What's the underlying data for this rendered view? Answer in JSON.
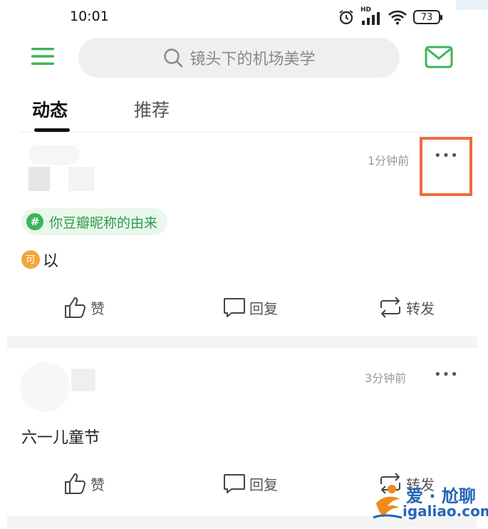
{
  "status_bar": {
    "time": "10:01",
    "signal_label": "HD",
    "battery": "73"
  },
  "header": {
    "search_placeholder": "镜头下的机场美学"
  },
  "tabs": [
    {
      "label": "动态"
    },
    {
      "label": "推荐"
    }
  ],
  "posts": [
    {
      "time": "1分钟前",
      "more": "•••",
      "topic": "你豆瓣昵称的由来",
      "emoji": "可",
      "text": "以",
      "actions": {
        "like": "赞",
        "reply": "回复",
        "repost": "转发"
      }
    },
    {
      "time": "3分钟前",
      "more": "•••",
      "text": "六一儿童节",
      "actions": {
        "like": "赞",
        "reply": "回复",
        "repost": "转发"
      }
    }
  ],
  "watermark": {
    "title": "爱 · 尬聊",
    "url": "igaliao.com"
  },
  "colors": {
    "accent": "#3bb55a",
    "highlight": "#ef6b3c",
    "watermark": "#2566b8"
  }
}
